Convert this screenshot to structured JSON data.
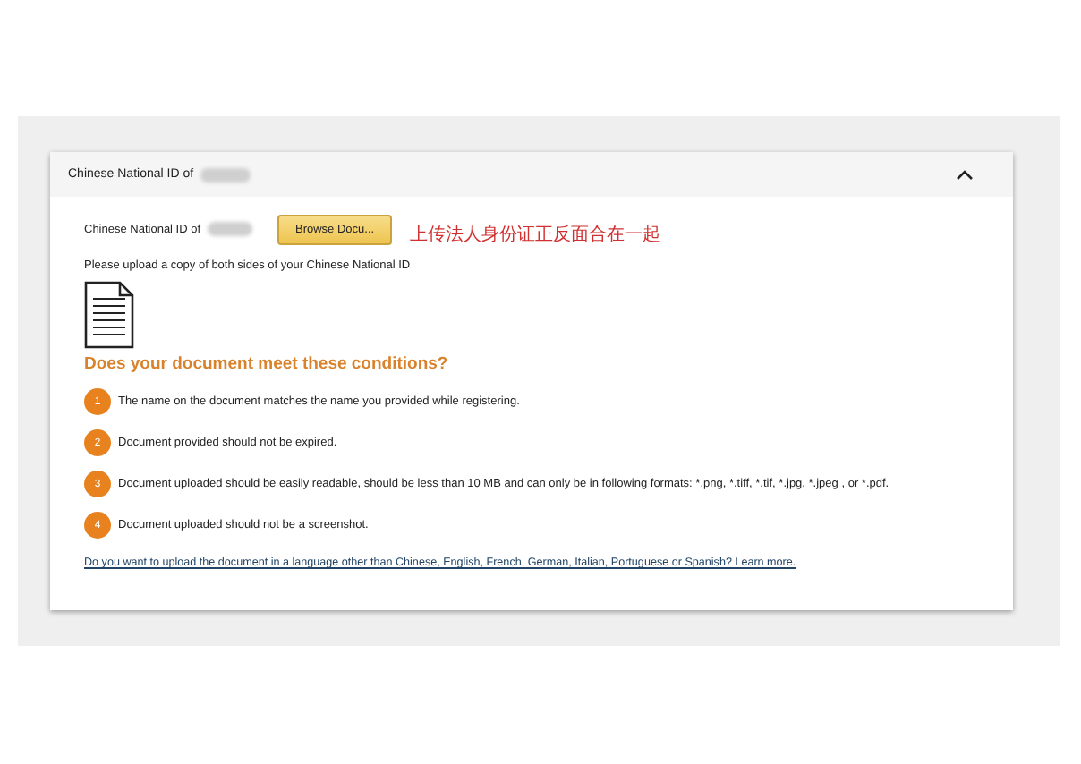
{
  "panel": {
    "title": "Chinese National ID of",
    "expanded": true
  },
  "upload": {
    "label": "Chinese National ID of",
    "button": "Browse Docu...",
    "note": "上传法人身份证正反面合在一起"
  },
  "instruction": "Please upload a copy of both sides of your Chinese National ID",
  "conditions_title": "Does your document meet these conditions?",
  "conditions": [
    {
      "number": "1",
      "text": "The name on the document matches the name you provided while registering."
    },
    {
      "number": "2",
      "text": "Document provided should not be expired."
    },
    {
      "number": "3",
      "text": "Document uploaded should be easily readable, should be less than 10 MB and can only be in following formats: *.png, *.tiff, *.tif, *.jpg, *.jpeg , or *.pdf."
    },
    {
      "number": "4",
      "text": "Document uploaded should not be a screenshot."
    }
  ],
  "link": "Do you want to upload the document in a language other than Chinese, English, French, German, Italian, Portuguese or Spanish? Learn more."
}
